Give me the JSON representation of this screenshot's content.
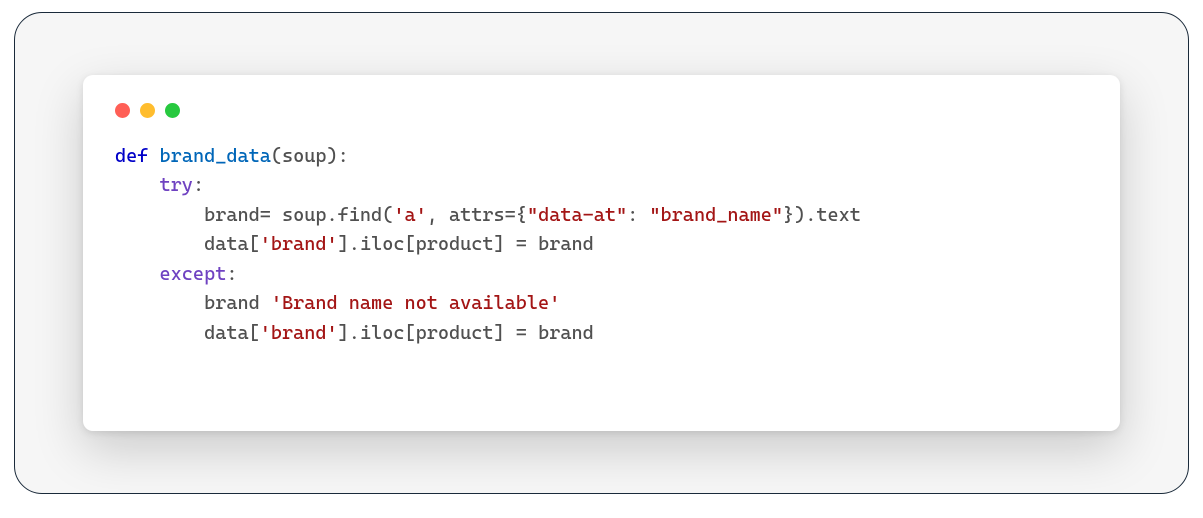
{
  "traffic_lights": {
    "red": "close",
    "yellow": "minimize",
    "green": "zoom"
  },
  "code": {
    "l1_def": "def",
    "l1_fn": "brand_data",
    "l1_rest": "(soup):",
    "l2_try": "try",
    "l2_colon": ":",
    "l3_a": "        brand= soup.find(",
    "l3_s1": "'a'",
    "l3_b": ", attrs={",
    "l3_s2": "\"data-at\"",
    "l3_c": ": ",
    "l3_s3": "\"brand_name\"",
    "l3_d": "}).text",
    "l4_a": "        data[",
    "l4_s1": "'brand'",
    "l4_b": "].iloc[product] = brand",
    "l5_except": "except",
    "l5_colon": ":",
    "l6_a": "        brand ",
    "l6_s1": "'Brand name not available'",
    "l7_a": "        data[",
    "l7_s1": "'brand'",
    "l7_b": "].iloc[product] = brand"
  }
}
